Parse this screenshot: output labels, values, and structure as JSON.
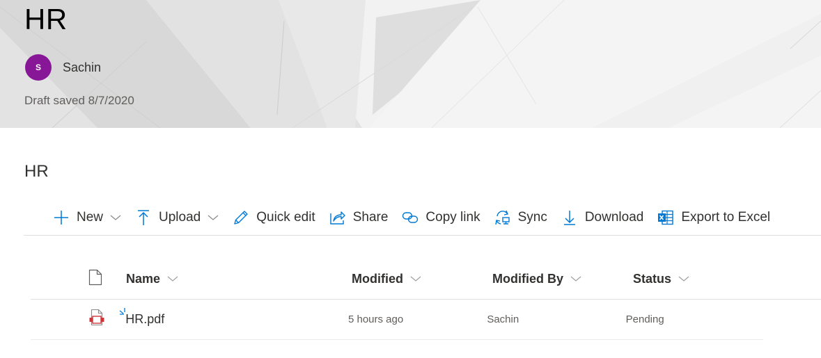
{
  "banner": {
    "title": "HR",
    "author": {
      "initials": "S",
      "name": "Sachin",
      "avatar_color": "#881798"
    },
    "draft_status": "Draft saved 8/7/2020"
  },
  "section": {
    "title": "HR"
  },
  "toolbar": {
    "accent_color": "#0078d4",
    "items": [
      {
        "label": "New",
        "icon": "plus-icon",
        "has_dropdown": true
      },
      {
        "label": "Upload",
        "icon": "upload-icon",
        "has_dropdown": true
      },
      {
        "label": "Quick edit",
        "icon": "pencil-icon",
        "has_dropdown": false
      },
      {
        "label": "Share",
        "icon": "share-icon",
        "has_dropdown": false
      },
      {
        "label": "Copy link",
        "icon": "link-icon",
        "has_dropdown": false
      },
      {
        "label": "Sync",
        "icon": "sync-icon",
        "has_dropdown": false
      },
      {
        "label": "Download",
        "icon": "download-icon",
        "has_dropdown": false
      },
      {
        "label": "Export to Excel",
        "icon": "excel-icon",
        "has_dropdown": false
      }
    ]
  },
  "list": {
    "columns": [
      {
        "label": "Name"
      },
      {
        "label": "Modified"
      },
      {
        "label": "Modified By"
      },
      {
        "label": "Status"
      }
    ],
    "rows": [
      {
        "name": "HR.pdf",
        "file_type": "pdf",
        "is_new": true,
        "modified": "5 hours ago",
        "modified_by": "Sachin",
        "status": "Pending"
      }
    ]
  }
}
